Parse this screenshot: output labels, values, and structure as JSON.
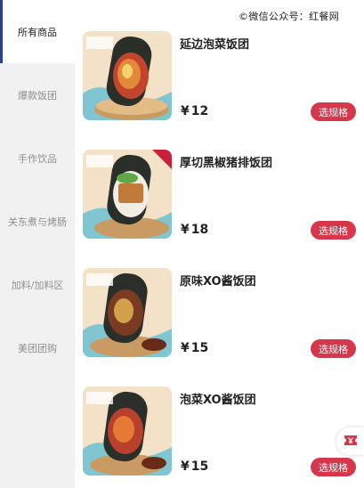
{
  "watermark": "©微信公众号：红餐网",
  "sidebar": {
    "items": [
      {
        "label": "所有商品"
      },
      {
        "label": "爆款饭团"
      },
      {
        "label": "手作饮品"
      },
      {
        "label": "关东煮与烤肠"
      },
      {
        "label": "加料/加料区"
      },
      {
        "label": "美团团购"
      }
    ]
  },
  "products": [
    {
      "name": "延边泡菜饭团",
      "currency": "¥",
      "price": "12",
      "button": "选规格"
    },
    {
      "name": "厚切黑椒猪排饭团",
      "currency": "¥",
      "price": "18",
      "button": "选规格"
    },
    {
      "name": "原味XO酱饭团",
      "currency": "¥",
      "price": "15",
      "button": "选规格"
    },
    {
      "name": "泡菜XO酱饭团",
      "currency": "¥",
      "price": "15",
      "button": "选规格"
    }
  ],
  "colors": {
    "accent": "#d7374b",
    "active_bar": "#2c3f97"
  },
  "floating": {
    "icon": "ticket-icon"
  }
}
